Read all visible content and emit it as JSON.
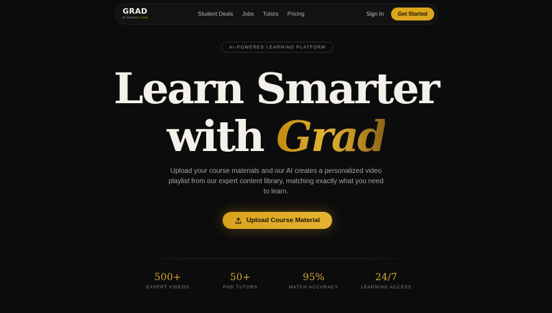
{
  "nav": {
    "logo_main": "GRAD",
    "logo_sub_prefix": "BY SCIENCE ",
    "logo_sub_suffix": "LEARN",
    "links": [
      "Student Deals",
      "Jobs",
      "Tutors",
      "Pricing"
    ],
    "signin": "Sign In",
    "cta": "Get Started"
  },
  "hero": {
    "badge": "AI-POWERED LEARNING PLATFORM",
    "title_line1": "Learn Smarter",
    "title_line2_prefix": "with ",
    "title_line2_highlight": "Grad",
    "subtitle": "Upload your course materials and our AI creates a personalized video playlist from our expert content library, matching exactly what you need to learn.",
    "upload_label": "Upload Course Material",
    "upload_icon": "upload-icon"
  },
  "stats": [
    {
      "value": "500+",
      "label": "EXPERT VIDEOS"
    },
    {
      "value": "50+",
      "label": "PHD TUTORS"
    },
    {
      "value": "95%",
      "label": "MATCH ACCURACY"
    },
    {
      "value": "24/7",
      "label": "LEARNING ACCESS"
    }
  ],
  "colors": {
    "background": "#0c0c0d",
    "accent": "#dca51e",
    "text": "#f4f1ea",
    "muted": "#a8a59e"
  }
}
